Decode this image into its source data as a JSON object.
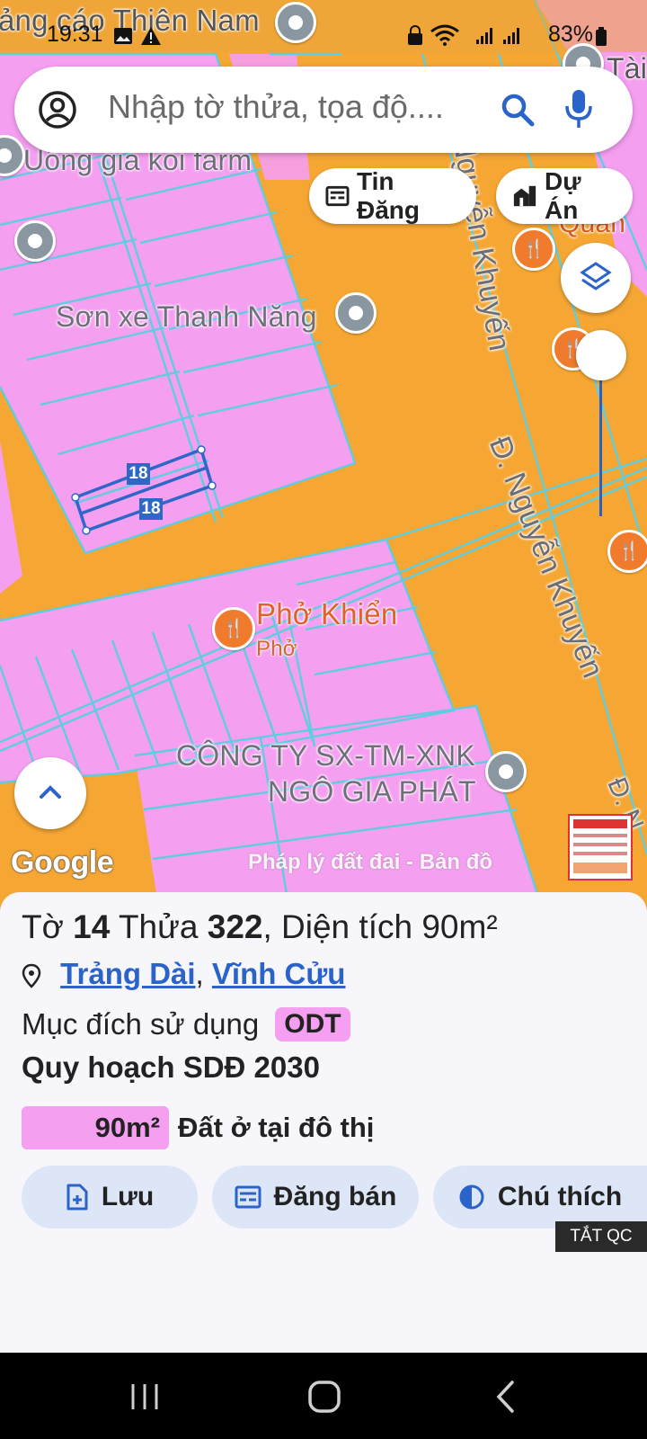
{
  "status_bar": {
    "time": "19:31",
    "right_text": "83%",
    "icons": [
      "image-icon",
      "warning-icon",
      "lock-icon",
      "wifi-icon",
      "signal-icon",
      "battery-icon"
    ]
  },
  "search": {
    "placeholder": "Nhập tờ thửa, tọa độ....",
    "account_icon": "account-icon",
    "search_icon": "search-icon",
    "mic_icon": "mic-icon"
  },
  "chips": {
    "listings": "Tin Đăng",
    "projects": "Dự Án"
  },
  "map": {
    "labels": {
      "top_partial": "ảng cáo Thiên Nam",
      "uong_gia": "Uông gia koi farm",
      "son_xe": "Sơn xe Thanh Năng",
      "pho_name": "Phở Khiển",
      "pho_sub": "Phở",
      "company_line1": "CÔNG TY SX-TM-XNK",
      "company_line2": "NGÔ GIA PHÁT",
      "road_1": "Nguyễn Khuyến",
      "road_2": "Đ. Nguyễn Khuyến",
      "right_edge_1": "Tài",
      "right_edge_2": "Quán",
      "right_edge_3": "Đ. N"
    },
    "parcel_numbers": [
      "18",
      "18"
    ],
    "google_logo": "Google",
    "watermark": "Pháp lý đất đai - Bản đồ"
  },
  "info": {
    "to_label": "Tờ",
    "to_value": "14",
    "thua_label": "Thửa",
    "thua_value": "322",
    "area_label": ", Diện tích",
    "area_value": "90m²",
    "ward": "Trảng Dài",
    "separator": ",",
    "district": "Vĩnh Cửu",
    "purpose_label": "Mục đích sử dụng",
    "purpose_code": "ODT",
    "plan_title": "Quy hoạch SDĐ 2030",
    "plan_area": "90m²",
    "plan_label": "Đất ở tại đô thị"
  },
  "actions": {
    "save": "Lưu",
    "post_sale": "Đăng bán",
    "legend": "Chú thích"
  },
  "ad_off_label": "TẮT QC",
  "colors": {
    "road_orange": "#f6a733",
    "residential_pink": "#f59ff1",
    "parcel_line": "#5ecde0",
    "accent_blue": "#2a63c9",
    "chip_bg": "#dde6f7"
  }
}
